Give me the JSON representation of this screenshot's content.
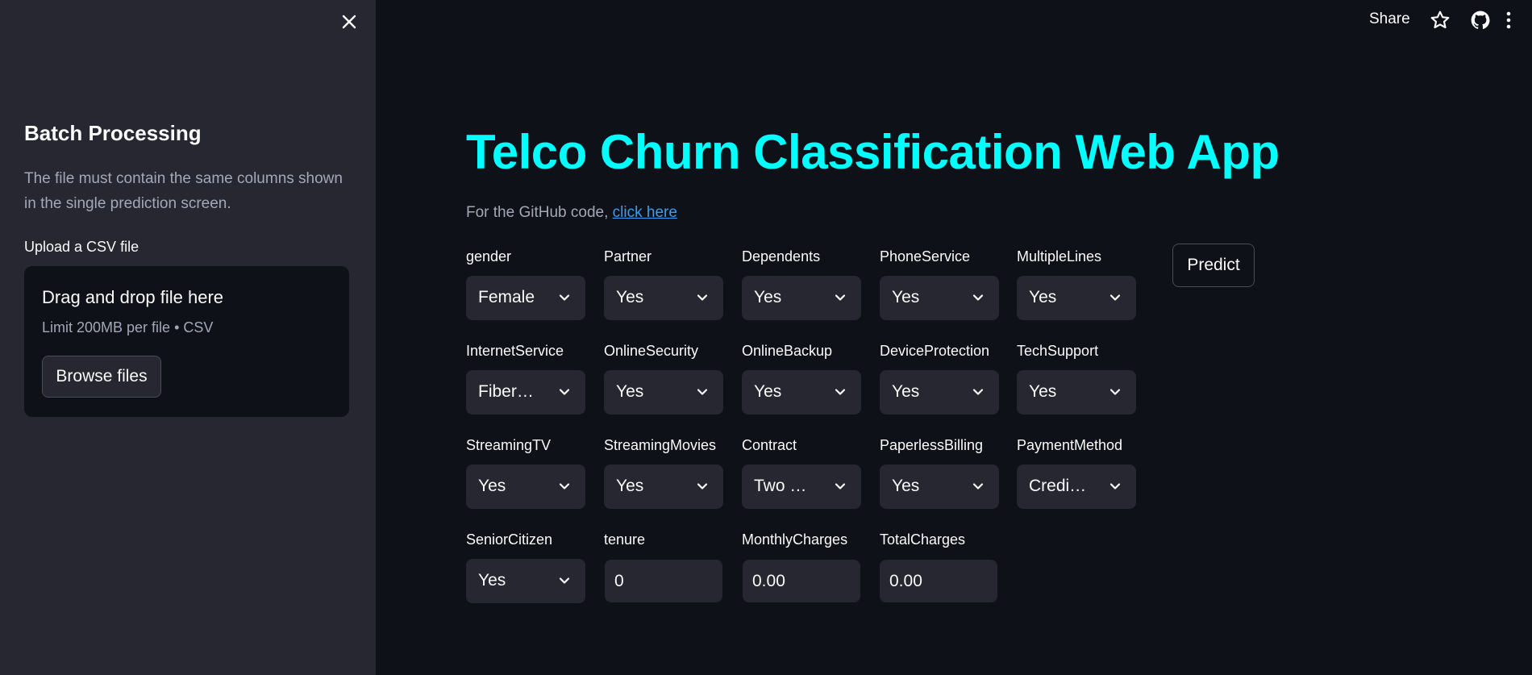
{
  "sidebar": {
    "title": "Batch Processing",
    "description": "The file must contain the same columns shown in the single prediction screen.",
    "upload_label": "Upload a CSV file",
    "dropzone_title": "Drag and drop file here",
    "dropzone_limit": "Limit 200MB per file • CSV",
    "browse_label": "Browse files",
    "close_icon": "close-icon"
  },
  "topbar": {
    "share_label": "Share",
    "icons": [
      "star-icon",
      "github-icon",
      "more-vert-icon"
    ]
  },
  "main": {
    "title": "Telco Churn Classification Web App",
    "github_prefix": "For the GitHub code, ",
    "github_link": "click here",
    "predict_label": "Predict",
    "fields": {
      "gender": {
        "label": "gender",
        "value": "Female"
      },
      "partner": {
        "label": "Partner",
        "value": "Yes"
      },
      "dependents": {
        "label": "Dependents",
        "value": "Yes"
      },
      "phone_service": {
        "label": "PhoneService",
        "value": "Yes"
      },
      "multiple_lines": {
        "label": "MultipleLines",
        "value": "Yes"
      },
      "internet_service": {
        "label": "InternetService",
        "value": "Fiber…"
      },
      "online_security": {
        "label": "OnlineSecurity",
        "value": "Yes"
      },
      "online_backup": {
        "label": "OnlineBackup",
        "value": "Yes"
      },
      "device_protection": {
        "label": "DeviceProtection",
        "value": "Yes"
      },
      "tech_support": {
        "label": "TechSupport",
        "value": "Yes"
      },
      "streaming_tv": {
        "label": "StreamingTV",
        "value": "Yes"
      },
      "streaming_movies": {
        "label": "StreamingMovies",
        "value": "Yes"
      },
      "contract": {
        "label": "Contract",
        "value": "Two …"
      },
      "paperless_billing": {
        "label": "PaperlessBilling",
        "value": "Yes"
      },
      "payment_method": {
        "label": "PaymentMethod",
        "value": "Credi…"
      },
      "senior_citizen": {
        "label": "SeniorCitizen",
        "value": "Yes"
      },
      "tenure": {
        "label": "tenure",
        "value": "0"
      },
      "monthly_charges": {
        "label": "MonthlyCharges",
        "value": "0.00"
      },
      "total_charges": {
        "label": "TotalCharges",
        "value": "0.00"
      }
    }
  },
  "colors": {
    "background": "#0e1117",
    "sidebar": "#262730",
    "title": "#00ffff",
    "link": "#3d9df3"
  }
}
